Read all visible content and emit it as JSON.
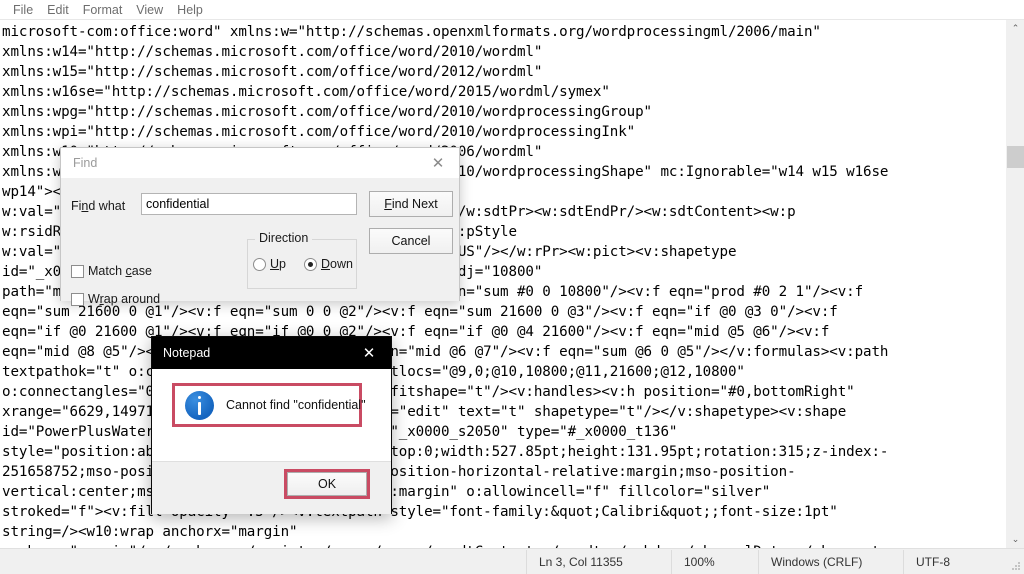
{
  "window": {
    "app_name": "Notepad"
  },
  "menubar": {
    "items": [
      {
        "label": "File"
      },
      {
        "label": "Edit"
      },
      {
        "label": "Format"
      },
      {
        "label": "View"
      },
      {
        "label": "Help"
      }
    ]
  },
  "editor": {
    "lines": [
      "microsoft-com:office:word\" xmlns:w=\"http://schemas.openxmlformats.org/wordprocessingml/2006/main\"",
      "xmlns:w14=\"http://schemas.microsoft.com/office/word/2010/wordml\"",
      "xmlns:w15=\"http://schemas.microsoft.com/office/word/2012/wordml\"",
      "xmlns:w16se=\"http://schemas.microsoft.com/office/word/2015/wordml/symex\"",
      "xmlns:wpg=\"http://schemas.microsoft.com/office/word/2010/wordprocessingGroup\"",
      "xmlns:wpi=\"http://schemas.microsoft.com/office/word/2010/wordprocessingInk\"",
      "xmlns:w10=\"http://schemas.microsoft.com/office/word/2006/wordml\"",
      "xmlns:wps=\"http://schemas.microsoft.com/office/word/2010/wordprocessingShape\" mc:Ignorable=\"w14 w15 w16se",
      "wp14\"><w:sdt><w:sdtPr><w:docPartObj><w:docPartGallery",
      "w:val=\"Watermarks\"/><w:docPartUnique/></w:docPartObj></w:sdtPr><w:sdtEndPr/><w:sdtContent><w:p",
      "w:rsidR=\"00D1569E\" w:rsidRDefault=\"00D1569E\"><w:pPr><w:pStyle",
      "w:val=\"Header\"/></w:pPr><w:r><w:rPr><w:lang w:val=\"en-US\"/></w:rPr><w:pict><v:shapetype",
      "id=\"_x0000_t136\" coordsize=\"21600,21600\" o:spt=\"136\" adj=\"10800\"",
      "path=\"m@7,l@8,m@5,21600l@6,21600e\"><v:formulas><v:f eqn=\"sum #0 0 10800\"/><v:f eqn=\"prod #0 2 1\"/><v:f",
      "eqn=\"sum 21600 0 @1\"/><v:f eqn=\"sum 0 0 @2\"/><v:f eqn=\"sum 21600 0 @3\"/><v:f eqn=\"if @0 @3 0\"/><v:f",
      "eqn=\"if @0 21600 @1\"/><v:f eqn=\"if @0 0 @2\"/><v:f eqn=\"if @0 @4 21600\"/><v:f eqn=\"mid @5 @6\"/><v:f",
      "eqn=\"mid @8 @5\"/><v:f eqn=\"mid @7 @8\"/><v:f eqn=\"mid @6 @7\"/><v:f eqn=\"sum @6 0 @5\"/></v:formulas><v:path",
      "textpathok=\"t\" o:connecttype=\"custom\" o:connectlocs=\"@9,0;@10,10800;@11,21600;@12,10800\"",
      "o:connectangles=\"0,0,0,0\"/><v:textpath on=\"t\" fitshape=\"t\"/><v:handles><v:h position=\"#0,bottomRight\"",
      "xrange=\"6629,14971\"/></v:handles><o:lock v:ext=\"edit\" text=\"t\" shapetype=\"t\"/></v:shapetype><v:shape",
      "id=\"PowerPlusWaterMarkObject357476642\" o:spid=\"_x0000_s2050\" type=\"#_x0000_t136\"",
      "style=\"position:absolute;margin-left:0;margin-top:0;width:527.85pt;height:131.95pt;rotation:315;z-index:-",
      "251658752;mso-position-horizontal:center;mso-position-horizontal-relative:margin;mso-position-",
      "vertical:center;mso-position-vertical-relative:margin\" o:allowincell=\"f\" fillcolor=\"silver\"",
      "stroked=\"f\"><v:fill opacity=\".5\"/><v:textpath style=\"font-family:&quot;Calibri&quot;;font-size:1pt\"",
      "string=/><w10:wrap anchorx=\"margin\"",
      "anchory=\"margin\"/></v:shape></w:pict></w:r></w:p></w:sdtContent></w:sdt></w:hdr></pkg:xmlData></pkg:part><"
    ]
  },
  "scrollbar": {
    "up_arrow": "⌃",
    "down_arrow": "⌄"
  },
  "statusbar": {
    "position": "Ln 3, Col 11355",
    "zoom": "100%",
    "line_ending": "Windows (CRLF)",
    "encoding": "UTF-8"
  },
  "find_dialog": {
    "title": "Find",
    "close_glyph": "✕",
    "find_what_label": "Find what",
    "find_what_value": "confidential",
    "find_what_placeholder": "",
    "find_next_label": "Find Next",
    "cancel_label": "Cancel",
    "direction_group_label": "Direction",
    "direction_options": [
      {
        "label": "Up",
        "selected": false
      },
      {
        "label": "Down",
        "selected": true
      }
    ],
    "match_case_label": "Match case",
    "match_case_checked": false,
    "wrap_around_label": "Wrap around",
    "wrap_around_checked": false
  },
  "message_box": {
    "title": "Notepad",
    "close_glyph": "✕",
    "message": "Cannot find \"confidential\"",
    "icon": "information-icon",
    "ok_label": "OK",
    "highlight_color": "#c94b63"
  }
}
